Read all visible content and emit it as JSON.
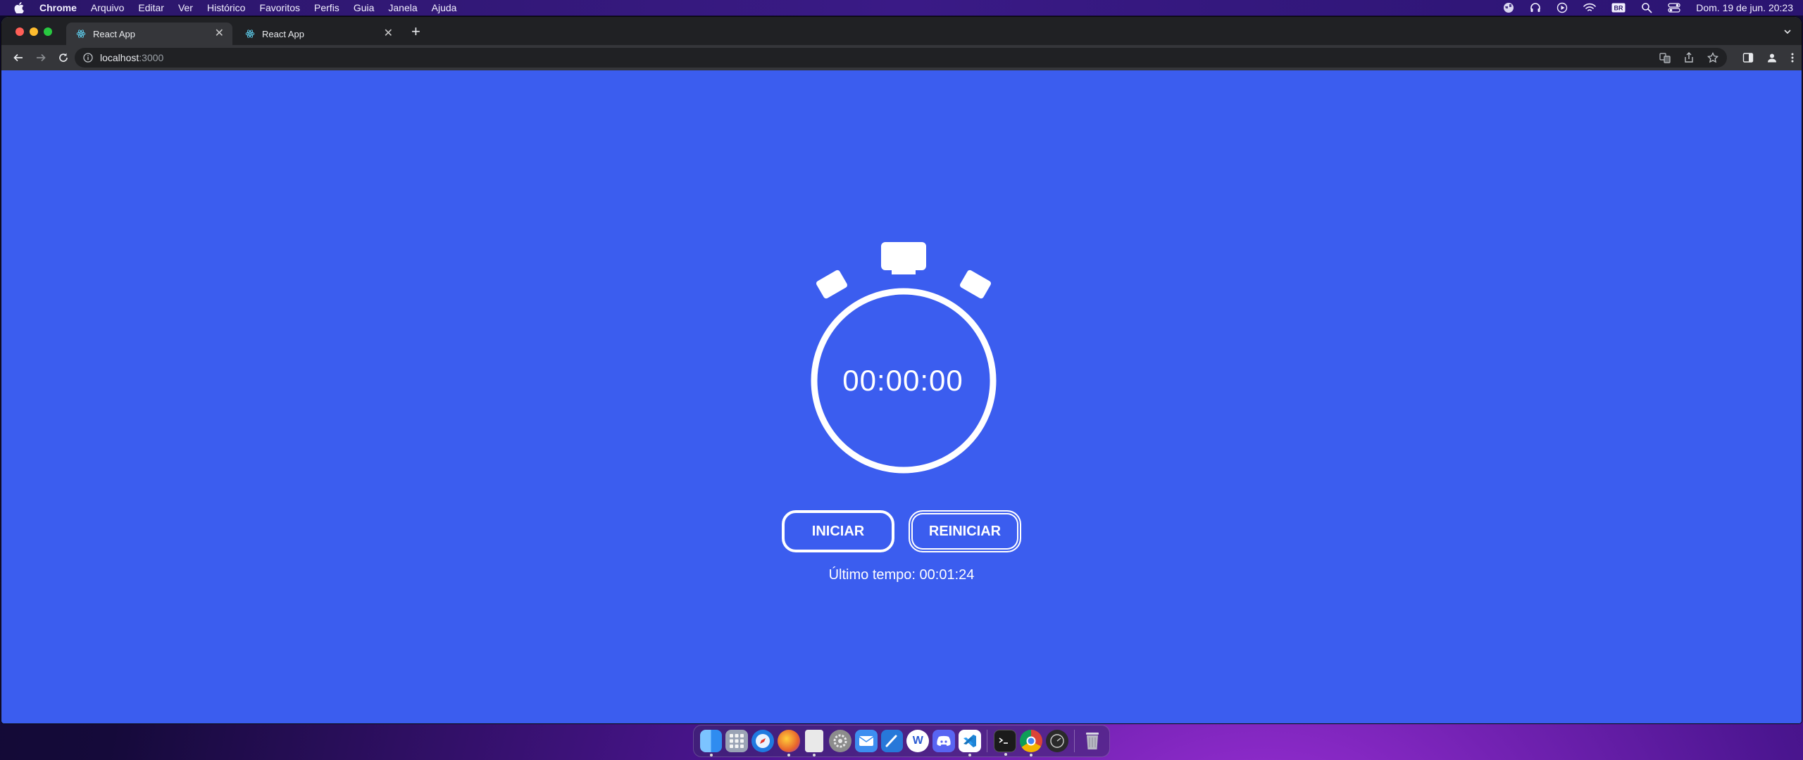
{
  "menubar": {
    "app_name": "Chrome",
    "menus": [
      "Arquivo",
      "Editar",
      "Ver",
      "Histórico",
      "Favoritos",
      "Perfis",
      "Guia",
      "Janela",
      "Ajuda"
    ],
    "status_icons": [
      "globe-icon",
      "headphones-icon",
      "play-circle-icon",
      "wifi-icon",
      "input-source-icon",
      "spotlight-search-icon",
      "control-center-icon"
    ],
    "input_source_label": "BR",
    "clock": "Dom. 19 de jun.  20:23"
  },
  "browser": {
    "tabs": [
      {
        "title": "React App",
        "icon": "react-icon",
        "active": true
      },
      {
        "title": "React App",
        "icon": "react-icon",
        "active": false
      }
    ],
    "address": {
      "host": "localhost",
      "port": ":3000"
    }
  },
  "stopwatch": {
    "display": "00:00:00",
    "start_label": "INICIAR",
    "reset_label": "REINICIAR",
    "last_time": "Último tempo: 00:01:24"
  },
  "colors": {
    "page_bg": "#3b5def",
    "foreground": "#ffffff"
  },
  "dock": {
    "apps": [
      {
        "name": "finder",
        "color": "#2f8cf0",
        "running": true
      },
      {
        "name": "launchpad",
        "color": "#9aa3b5",
        "running": false
      },
      {
        "name": "safari",
        "color": "#1f7ae0",
        "running": false
      },
      {
        "name": "firefox",
        "color": "#e8642c",
        "running": true
      },
      {
        "name": "textedit",
        "color": "#e9e9e9",
        "running": true
      },
      {
        "name": "system-preferences",
        "color": "#8c8c8c",
        "running": false
      },
      {
        "name": "mail",
        "color": "#3d8ef0",
        "running": false
      },
      {
        "name": "xcode",
        "color": "#2778d9",
        "running": false
      },
      {
        "name": "word",
        "color": "#2b5bd3",
        "running": false
      },
      {
        "name": "discord",
        "color": "#5865f2",
        "running": false
      },
      {
        "name": "vscode",
        "color": "#1e84d6",
        "running": true
      },
      {
        "name": "terminal",
        "color": "#1b1b1b",
        "running": true
      },
      {
        "name": "chrome",
        "color": "#e8e8e8",
        "running": true
      },
      {
        "name": "activity-monitor",
        "color": "#2a2a2a",
        "running": false
      },
      {
        "name": "trash",
        "color": "#b8b8c4",
        "running": false
      }
    ]
  }
}
